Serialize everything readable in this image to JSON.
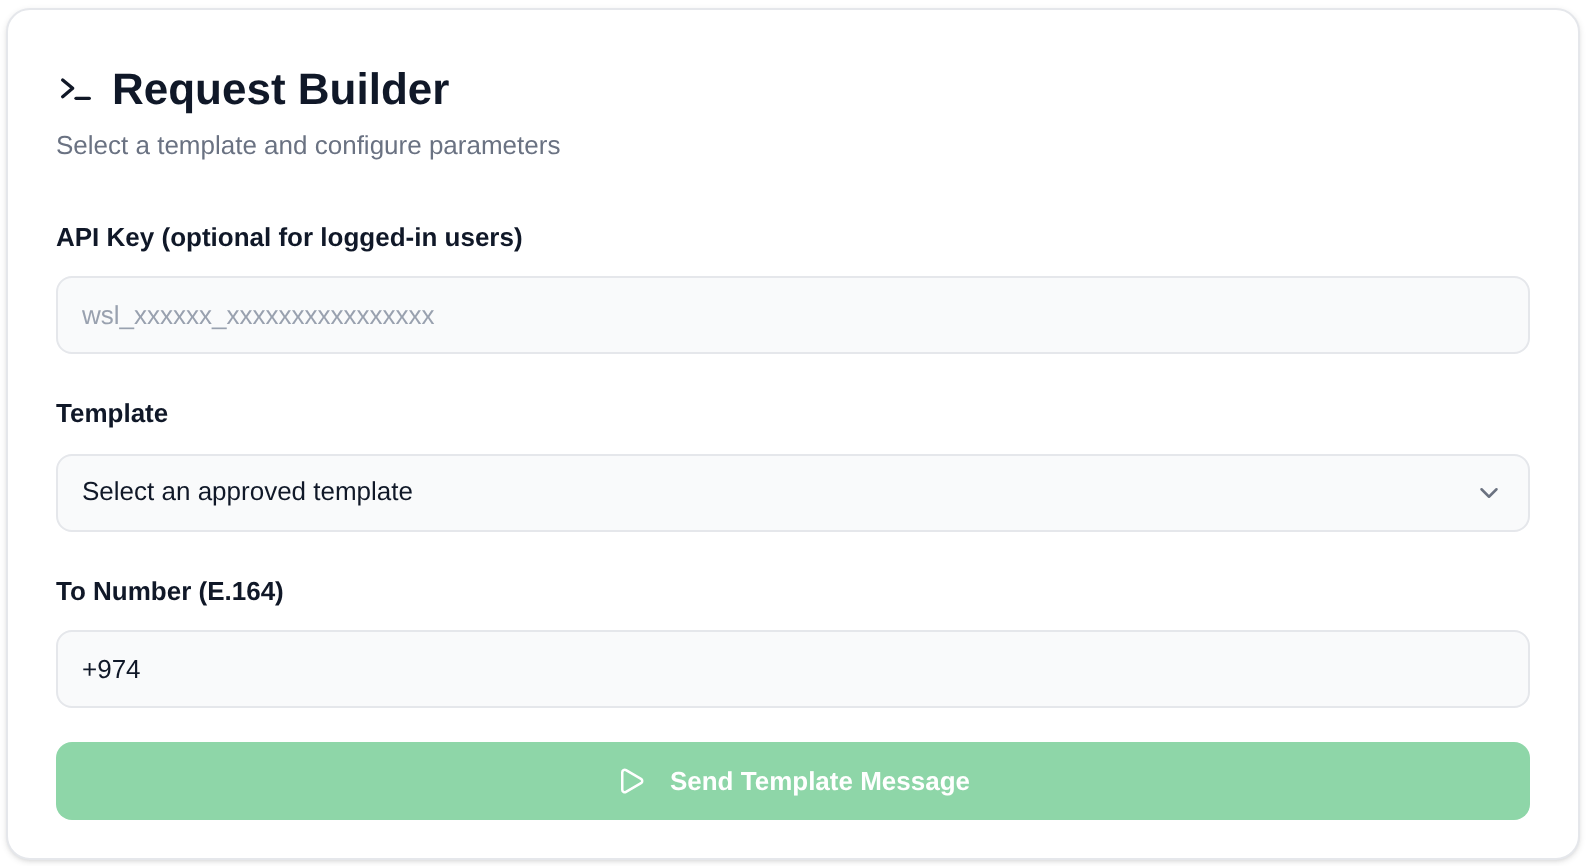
{
  "header": {
    "title": "Request Builder",
    "subtitle": "Select a template and configure parameters"
  },
  "fields": [
    {
      "kind": "input",
      "label": "API Key (optional for logged-in users)",
      "placeholder": "wsl_xxxxxx_xxxxxxxxxxxxxxxx"
    },
    {
      "kind": "select",
      "label": "Template",
      "value": "Select an approved template"
    },
    {
      "kind": "input",
      "label": "To Number (E.164)",
      "value": "+974"
    }
  ],
  "submit": {
    "label": "Send Template Message",
    "disabled": true
  }
}
